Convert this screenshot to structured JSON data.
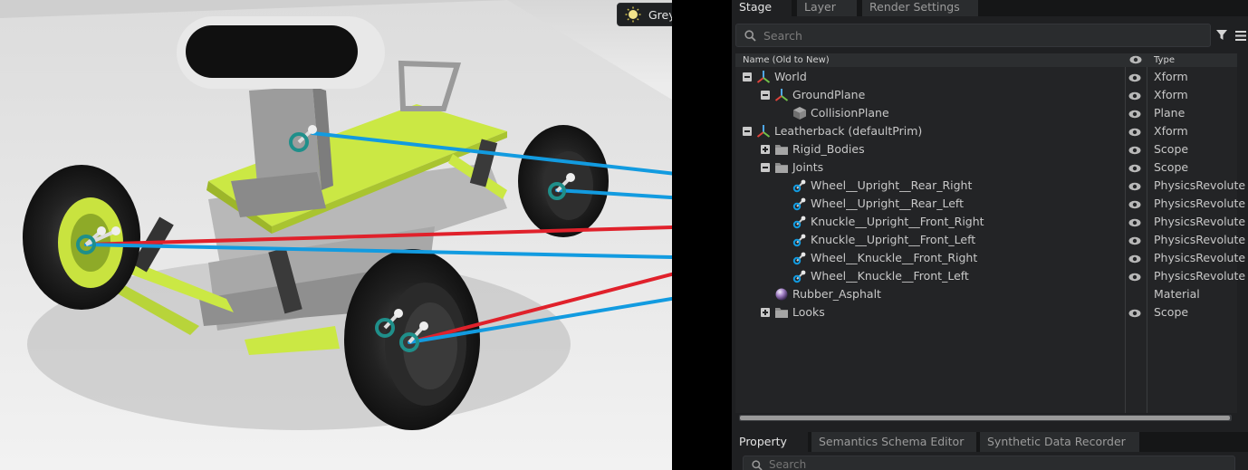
{
  "viewport": {
    "light_rig_label": "Grey Studio",
    "light_rig_icon": "sun-icon"
  },
  "stage_panel": {
    "tabs": [
      {
        "label": "Stage",
        "active": true
      },
      {
        "label": "Layer",
        "active": false
      },
      {
        "label": "Render Settings",
        "active": false
      }
    ],
    "search_placeholder": "Search",
    "columns": {
      "name": "Name (Old to New)",
      "visibility_icon": "eye-icon",
      "type": "Type"
    },
    "tree": [
      {
        "label": "World",
        "type": "Xform",
        "depth": 0,
        "expander": "collapse",
        "icon": "xform-axes-icon",
        "visible": true
      },
      {
        "label": "GroundPlane",
        "type": "Xform",
        "depth": 1,
        "expander": "collapse",
        "icon": "xform-axes-icon",
        "visible": true
      },
      {
        "label": "CollisionPlane",
        "type": "Plane",
        "depth": 2,
        "expander": "none",
        "icon": "mesh-cube-icon",
        "visible": true
      },
      {
        "label": "Leatherback (defaultPrim)",
        "type": "Xform",
        "depth": 0,
        "expander": "collapse",
        "icon": "xform-axes-icon",
        "visible": true
      },
      {
        "label": "Rigid_Bodies",
        "type": "Scope",
        "depth": 1,
        "expander": "expand",
        "icon": "folder-icon",
        "visible": true
      },
      {
        "label": "Joints",
        "type": "Scope",
        "depth": 1,
        "expander": "collapse",
        "icon": "folder-icon",
        "visible": true
      },
      {
        "label": "Wheel__Upright__Rear_Right",
        "type": "PhysicsRevolute",
        "depth": 2,
        "expander": "none",
        "icon": "revolute-joint-icon",
        "visible": true
      },
      {
        "label": "Wheel__Upright__Rear_Left",
        "type": "PhysicsRevolute",
        "depth": 2,
        "expander": "none",
        "icon": "revolute-joint-icon",
        "visible": true
      },
      {
        "label": "Knuckle__Upright__Front_Right",
        "type": "PhysicsRevolute",
        "depth": 2,
        "expander": "none",
        "icon": "revolute-joint-icon",
        "visible": true
      },
      {
        "label": "Knuckle__Upright__Front_Left",
        "type": "PhysicsRevolute",
        "depth": 2,
        "expander": "none",
        "icon": "revolute-joint-icon",
        "visible": true
      },
      {
        "label": "Wheel__Knuckle__Front_Right",
        "type": "PhysicsRevolute",
        "depth": 2,
        "expander": "none",
        "icon": "revolute-joint-icon",
        "visible": true
      },
      {
        "label": "Wheel__Knuckle__Front_Left",
        "type": "PhysicsRevolute",
        "depth": 2,
        "expander": "none",
        "icon": "revolute-joint-icon",
        "visible": true
      },
      {
        "label": "Rubber_Asphalt",
        "type": "Material",
        "depth": 1,
        "expander": "none",
        "icon": "material-sphere-icon",
        "visible": false
      },
      {
        "label": "Looks",
        "type": "Scope",
        "depth": 1,
        "expander": "expand",
        "icon": "folder-icon",
        "visible": true
      }
    ]
  },
  "property_panel": {
    "tabs": [
      {
        "label": "Property",
        "active": true
      },
      {
        "label": "Semantics Schema Editor",
        "active": false
      },
      {
        "label": "Synthetic Data Recorder",
        "active": false
      }
    ],
    "search_placeholder": "Search"
  },
  "annotation_colors": {
    "blue": "#129be0",
    "red": "#e0212b",
    "handle_teal": "#1f8f8a"
  }
}
